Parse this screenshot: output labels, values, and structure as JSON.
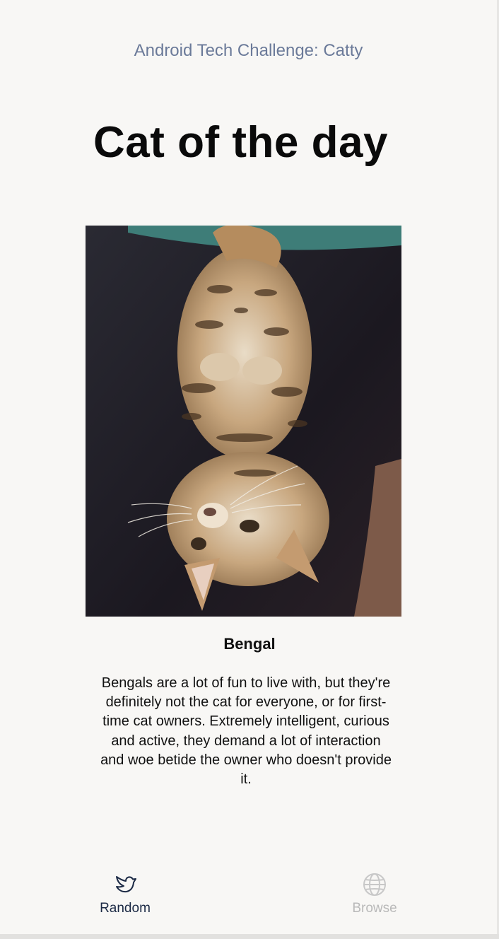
{
  "header": {
    "app_title": "Android Tech Challenge: Catty",
    "page_title": "Cat of the day"
  },
  "cat": {
    "image_alt": "Bengal cat photo",
    "breed": "Bengal",
    "description": "Bengals are a lot of fun to live with, but they're definitely not the cat for everyone, or for first-time cat owners. Extremely intelligent, curious and active, they demand a lot of interaction and woe betide the owner who doesn't provide it."
  },
  "nav": {
    "items": [
      {
        "label": "Random",
        "icon": "bird-icon",
        "active": true
      },
      {
        "label": "Browse",
        "icon": "globe-icon",
        "active": false
      }
    ]
  },
  "colors": {
    "background": "#f8f7f5",
    "app_title": "#6b7a99",
    "active_nav": "#1c2a45",
    "inactive_nav": "#b9b9b9"
  }
}
